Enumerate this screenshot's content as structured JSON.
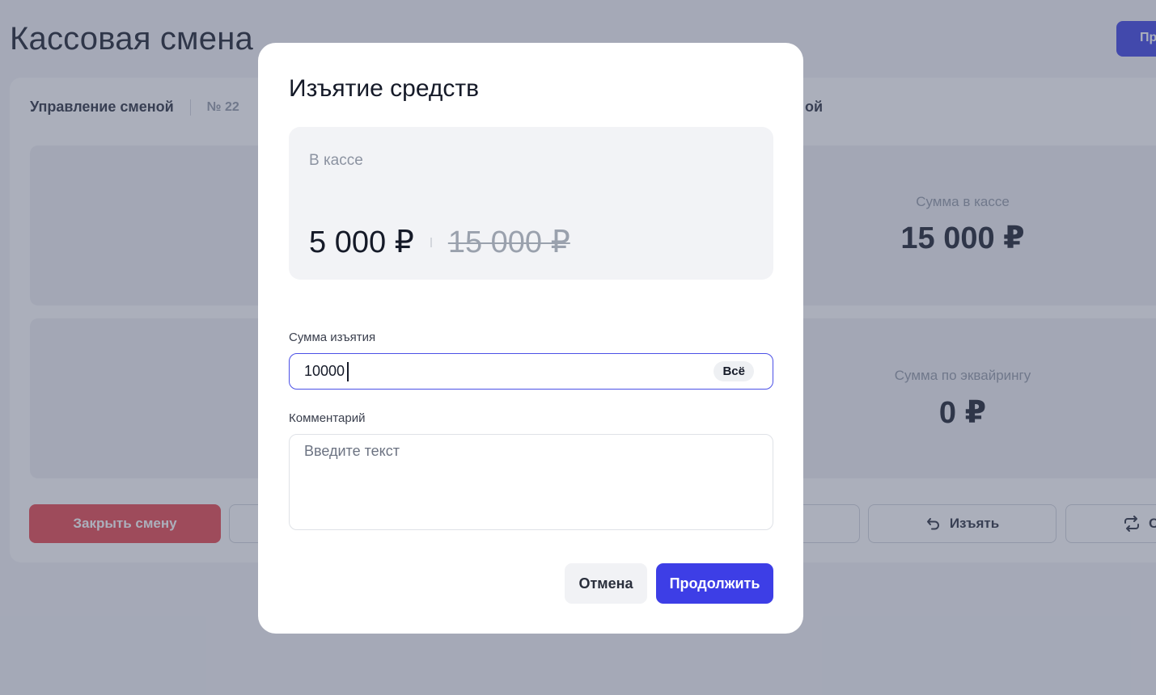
{
  "background": {
    "page_title": "Кассовая смена",
    "top_action_label": "Про",
    "tabs": {
      "manage": "Управление сменой",
      "number": "№ 22",
      "right_tab_fragment": "ой"
    },
    "stats": {
      "cash_sum_label": "Сумма в кассе",
      "cash_sum_value": "15 000 ₽",
      "acquiring_label": "Сумма по эквайрингу",
      "acquiring_value": "0 ₽"
    },
    "buttons": {
      "close_shift": "Закрыть смену",
      "withdraw": "Изъять",
      "refresh_fragment": "С"
    }
  },
  "modal": {
    "title": "Изъятие средств",
    "cash": {
      "label": "В кассе",
      "new_amount": "5 000 ₽",
      "old_amount": "15 000 ₽"
    },
    "amount": {
      "label": "Сумма изъятия",
      "value": "10000",
      "all_button": "Всё"
    },
    "comment": {
      "label": "Комментарий",
      "placeholder": "Введите текст"
    },
    "actions": {
      "cancel": "Отмена",
      "continue": "Продолжить"
    }
  },
  "colors": {
    "accent": "#3d3ee6",
    "danger": "#e9545a",
    "overlay": "#36405c"
  }
}
